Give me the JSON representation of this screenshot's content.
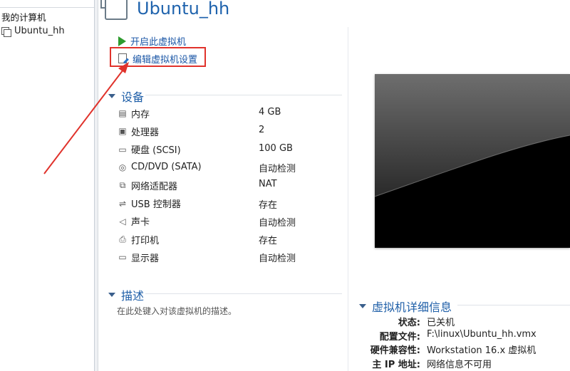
{
  "library": {
    "root_label": "我的计算机",
    "vm_name": "Ubuntu_hh"
  },
  "header": {
    "title": "Ubuntu_hh"
  },
  "commands": {
    "power_on": "开启此虚拟机",
    "edit_settings": "编辑虚拟机设置"
  },
  "devices": {
    "heading": "设备",
    "items": [
      {
        "icon": "memory-icon",
        "label": "内存",
        "value": "4 GB"
      },
      {
        "icon": "processor-icon",
        "label": "处理器",
        "value": "2"
      },
      {
        "icon": "hard-disk-icon",
        "label": "硬盘 (SCSI)",
        "value": "100 GB"
      },
      {
        "icon": "cd-dvd-icon",
        "label": "CD/DVD (SATA)",
        "value": "自动检测"
      },
      {
        "icon": "network-adapter-icon",
        "label": "网络适配器",
        "value": "NAT"
      },
      {
        "icon": "usb-icon",
        "label": "USB 控制器",
        "value": "存在"
      },
      {
        "icon": "sound-card-icon",
        "label": "声卡",
        "value": "自动检测"
      },
      {
        "icon": "printer-icon",
        "label": "打印机",
        "value": "存在"
      },
      {
        "icon": "display-icon",
        "label": "显示器",
        "value": "自动检测"
      }
    ]
  },
  "description": {
    "heading": "描述",
    "placeholder": "在此处键入对该虚拟机的描述。"
  },
  "details": {
    "heading": "虚拟机详细信息",
    "rows": [
      {
        "key": "状态:",
        "value": "已关机"
      },
      {
        "key": "配置文件:",
        "value": "F:\\linux\\Ubuntu_hh.vmx"
      },
      {
        "key": "硬件兼容性:",
        "value": "Workstation 16.x 虚拟机"
      },
      {
        "key": "主 IP 地址:",
        "value": "网络信息不可用"
      }
    ]
  },
  "colors": {
    "accent_blue": "#1f63ad",
    "highlight_red": "#e0322b",
    "play_green": "#2e9b2e"
  }
}
